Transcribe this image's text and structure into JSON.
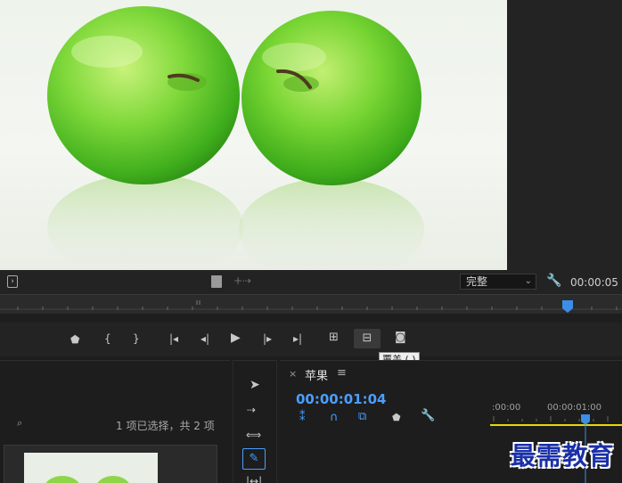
{
  "monitor": {
    "quality_label": "完整",
    "timecode": "00:00:05"
  },
  "tooltip": {
    "text": "覆盖 (.)"
  },
  "project": {
    "selection_status": "1 项已选择，共 2 项"
  },
  "timeline": {
    "close_label": "×",
    "sequence_name": "苹果",
    "menu_label": "≡",
    "current_timecode": "00:00:01:04",
    "ruler_labels": [
      ":00:00",
      "00:00:01:00"
    ]
  },
  "watermark": {
    "text": "最需教育"
  },
  "colors": {
    "accent": "#4a9eff",
    "playhead": "#3c8ee8",
    "work_area": "#e8d800"
  },
  "icons": [
    "export-frame-icon",
    "gear-wrench-icon",
    "marker-icon",
    "mark-in-icon",
    "mark-out-icon",
    "go-to-in-icon",
    "step-back-icon",
    "play-icon",
    "step-forward-icon",
    "go-to-out-icon",
    "insert-icon",
    "overwrite-icon",
    "camera-icon",
    "selection-tool-icon",
    "track-select-icon",
    "ripple-edit-icon",
    "razor-tool-icon",
    "slip-tool-icon",
    "snap-icon",
    "linked-selection-icon",
    "add-marker-icon",
    "timeline-settings-icon",
    "find-icon"
  ]
}
